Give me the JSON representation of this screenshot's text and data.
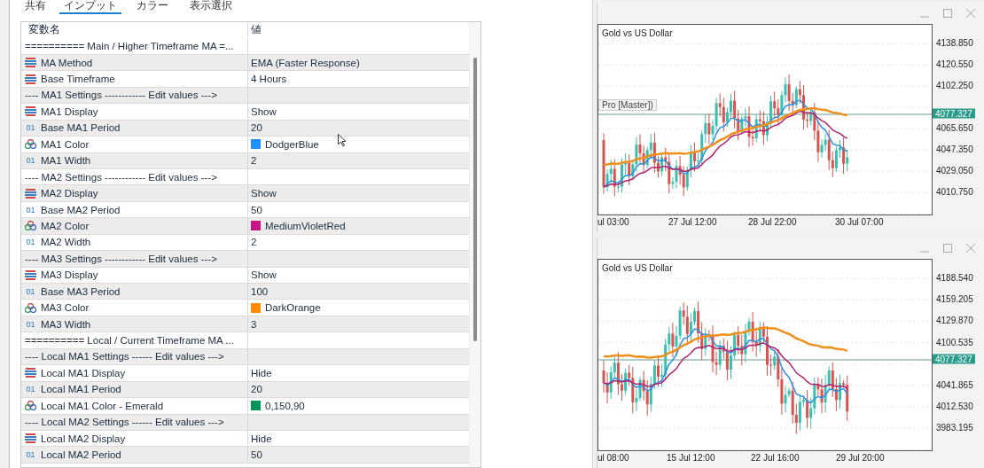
{
  "tabs": [
    {
      "label": "共有",
      "selected": false
    },
    {
      "label": "インプット",
      "selected": true
    },
    {
      "label": "カラー",
      "selected": false
    },
    {
      "label": "表示選択",
      "selected": false
    }
  ],
  "table": {
    "columns": [
      "変数名",
      "値"
    ],
    "rows": [
      {
        "kind": "separator",
        "name": "========== Main / Higher Timeframe MA =..."
      },
      {
        "kind": "enum",
        "name": "MA Method",
        "value": "EMA (Faster Response)"
      },
      {
        "kind": "enum",
        "name": "Base Timeframe",
        "value": "4 Hours"
      },
      {
        "kind": "separator",
        "name": "---- MA1 Settings ------------ Edit values --->"
      },
      {
        "kind": "enum",
        "name": "MA1 Display",
        "value": "Show"
      },
      {
        "kind": "int",
        "icon_text": "01",
        "name": "Base MA1 Period",
        "value": "20"
      },
      {
        "kind": "color",
        "name": "MA1 Color",
        "value": "DodgerBlue",
        "color": "#1e90ff"
      },
      {
        "kind": "int",
        "icon_text": "01",
        "name": "MA1 Width",
        "value": "2"
      },
      {
        "kind": "separator",
        "name": "---- MA2 Settings ------------ Edit values --->"
      },
      {
        "kind": "enum",
        "name": "MA2 Display",
        "value": "Show"
      },
      {
        "kind": "int",
        "icon_text": "01",
        "name": "Base MA2 Period",
        "value": "50"
      },
      {
        "kind": "color",
        "name": "MA2 Color",
        "value": "MediumVioletRed",
        "color": "#c71585"
      },
      {
        "kind": "int",
        "icon_text": "01",
        "name": "MA2 Width",
        "value": "2"
      },
      {
        "kind": "separator",
        "name": "---- MA3 Settings ------------ Edit values --->"
      },
      {
        "kind": "enum",
        "name": "MA3 Display",
        "value": "Show"
      },
      {
        "kind": "int",
        "icon_text": "01",
        "name": "Base MA3 Period",
        "value": "100"
      },
      {
        "kind": "color",
        "name": "MA3 Color",
        "value": "DarkOrange",
        "color": "#ff8c00"
      },
      {
        "kind": "int",
        "icon_text": "01",
        "name": "MA3 Width",
        "value": "3"
      },
      {
        "kind": "separator",
        "name": "========== Local / Current Timeframe MA ..."
      },
      {
        "kind": "separator",
        "name": "---- Local MA1 Settings ------ Edit values --->"
      },
      {
        "kind": "enum",
        "name": "Local MA1 Display",
        "value": "Hide"
      },
      {
        "kind": "int",
        "icon_text": "01",
        "name": "Local MA1 Period",
        "value": "20"
      },
      {
        "kind": "color",
        "name": "Local MA1 Color - Emerald",
        "value": "0,150,90",
        "color": "#00965a"
      },
      {
        "kind": "separator",
        "name": "---- Local MA2 Settings ------ Edit values --->"
      },
      {
        "kind": "enum",
        "name": "Local MA2 Display",
        "value": "Hide"
      },
      {
        "kind": "int",
        "icon_text": "01",
        "name": "Local MA2 Period",
        "value": "50"
      }
    ]
  },
  "charts": [
    {
      "symbol": "Gold vs US Dollar",
      "indicator_label": "Pro [Master])",
      "price_labels": [
        "4138.850",
        "4120.550",
        "4102.250",
        "4065.650",
        "4047.350",
        "4029.050",
        "4010.750"
      ],
      "current_price": "4077.327",
      "time_labels": [
        "ul 03:00",
        "27 Jul 12:00",
        "28 Jul 22:00",
        "30 Jul 07:00"
      ]
    },
    {
      "symbol": "Gold vs US Dollar",
      "price_labels": [
        "4188.540",
        "4159.205",
        "4129.870",
        "4100.535",
        "4041.865",
        "4012.530",
        "3983.195"
      ],
      "current_price": "4077.327",
      "time_labels": [
        "ul 08:00",
        "15 Jul 12:00",
        "22 Jul 16:00",
        "29 Jul 20:00"
      ]
    }
  ]
}
